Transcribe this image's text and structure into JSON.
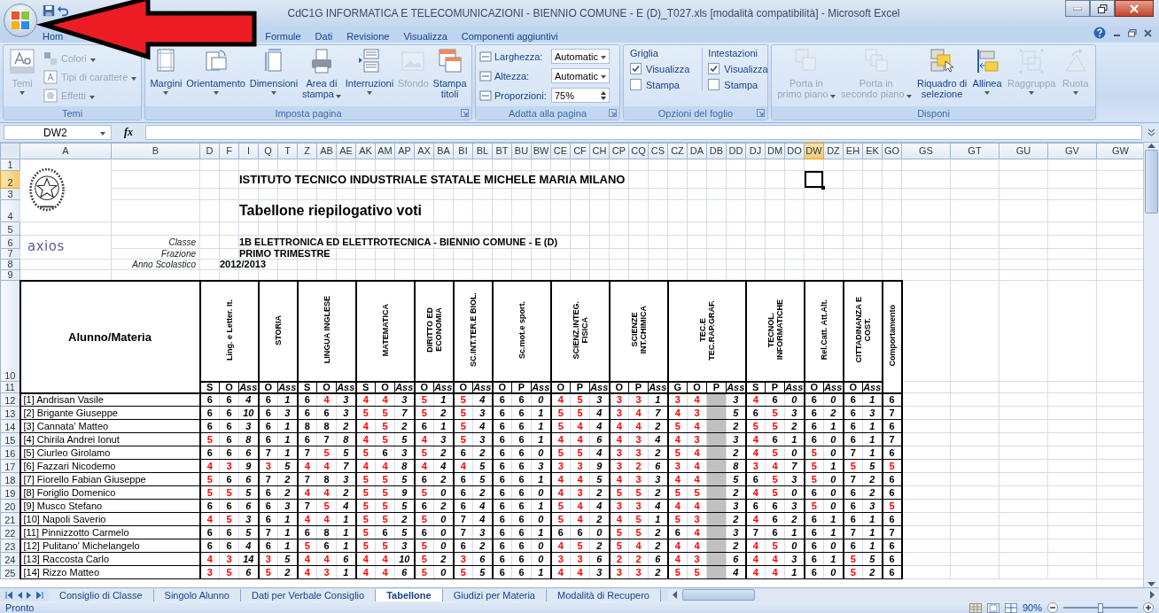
{
  "window": {
    "title": "CdC1G INFORMATICA E TELECOMUNICAZIONI - BIENNIO COMUNE - E (D)_T027.xls  [modalità compatibilità] - Microsoft Excel"
  },
  "ribbon": {
    "tabs": [
      {
        "label": "Hom",
        "selected": false
      },
      {
        "label": "Formule",
        "selected": false
      },
      {
        "label": "Dati",
        "selected": false
      },
      {
        "label": "Revisione",
        "selected": false
      },
      {
        "label": "Visualizza",
        "selected": false
      },
      {
        "label": "Componenti aggiuntivi",
        "selected": false
      }
    ],
    "groups": [
      {
        "kind": "themes",
        "label": "Temi",
        "main": {
          "label": "Temi",
          "disabled": true
        },
        "options": [
          {
            "label": "Colori",
            "disabled": true
          },
          {
            "label": "Tipi di carattere",
            "disabled": true
          },
          {
            "label": "Effetti",
            "disabled": true
          }
        ]
      },
      {
        "kind": "buttons",
        "label": "Imposta pagina",
        "launcher": true,
        "buttons": [
          {
            "label": "Margini",
            "menu": true,
            "disabled": false
          },
          {
            "label": "Orientamento",
            "menu": true,
            "disabled": false
          },
          {
            "label": "Dimensioni",
            "menu": true,
            "disabled": false
          },
          {
            "label": "Area di\nstampa",
            "menu": true,
            "disabled": false
          },
          {
            "label": "Interruzioni",
            "menu": true,
            "disabled": false
          },
          {
            "label": "Sfondo",
            "menu": false,
            "disabled": true
          },
          {
            "label": "Stampa\ntitoli",
            "menu": false,
            "disabled": false
          }
        ]
      },
      {
        "kind": "fit",
        "label": "Adatta alla pagina",
        "launcher": true,
        "fields": [
          {
            "kind": "combo",
            "label": "Larghezza:",
            "value": "Automatic"
          },
          {
            "kind": "combo",
            "label": "Altezza:",
            "value": "Automatic"
          },
          {
            "kind": "spin",
            "label": "Proporzioni:",
            "value": "75%"
          }
        ]
      },
      {
        "kind": "sheet_options",
        "label": "Opzioni del foglio",
        "launcher": true,
        "sections": [
          {
            "heading": "Griglia",
            "options": [
              {
                "label": "Visualizza",
                "checked": true
              },
              {
                "label": "Stampa",
                "checked": false
              }
            ]
          },
          {
            "heading": "Intestazioni",
            "options": [
              {
                "label": "Visualizza",
                "checked": true
              },
              {
                "label": "Stampa",
                "checked": false
              }
            ]
          }
        ]
      },
      {
        "kind": "buttons",
        "label": "Disponi",
        "launcher": false,
        "buttons": [
          {
            "label": "Porta in\nprimo piano",
            "menu": true,
            "disabled": true
          },
          {
            "label": "Porta in\nsecondo piano",
            "menu": true,
            "disabled": true
          },
          {
            "label": "Riquadro di\nselezione",
            "menu": false,
            "disabled": false
          },
          {
            "label": "Allinea",
            "menu": true,
            "disabled": false
          },
          {
            "label": "Raggruppa",
            "menu": true,
            "disabled": true
          },
          {
            "label": "Ruota",
            "menu": true,
            "disabled": true
          }
        ]
      }
    ]
  },
  "formula_bar": {
    "name_box": "DW2",
    "function_label": "fx"
  },
  "grid": {
    "columns": [
      {
        "label": "A",
        "selected": false
      },
      {
        "label": "B",
        "selected": false
      },
      {
        "label": "D",
        "selected": false
      },
      {
        "label": "F",
        "selected": false
      },
      {
        "label": "I",
        "selected": false
      },
      {
        "label": "Q",
        "selected": false
      },
      {
        "label": "T",
        "selected": false
      },
      {
        "label": "Z",
        "selected": false
      },
      {
        "label": "AB",
        "selected": false
      },
      {
        "label": "AE",
        "selected": false
      },
      {
        "label": "AK",
        "selected": false
      },
      {
        "label": "AM",
        "selected": false
      },
      {
        "label": "AP",
        "selected": false
      },
      {
        "label": "AX",
        "selected": false
      },
      {
        "label": "BA",
        "selected": false
      },
      {
        "label": "BI",
        "selected": false
      },
      {
        "label": "BL",
        "selected": false
      },
      {
        "label": "BT",
        "selected": false
      },
      {
        "label": "BU",
        "selected": false
      },
      {
        "label": "BW",
        "selected": false
      },
      {
        "label": "CE",
        "selected": false
      },
      {
        "label": "CF",
        "selected": false
      },
      {
        "label": "CH",
        "selected": false
      },
      {
        "label": "CP",
        "selected": false
      },
      {
        "label": "CQ",
        "selected": false
      },
      {
        "label": "CS",
        "selected": false
      },
      {
        "label": "CZ",
        "selected": false
      },
      {
        "label": "DA",
        "selected": false
      },
      {
        "label": "DB",
        "selected": false
      },
      {
        "label": "DD",
        "selected": false
      },
      {
        "label": "DJ",
        "selected": false
      },
      {
        "label": "DM",
        "selected": false
      },
      {
        "label": "DO",
        "selected": false
      },
      {
        "label": "DW",
        "selected": true
      },
      {
        "label": "DZ",
        "selected": false
      },
      {
        "label": "EH",
        "selected": false
      },
      {
        "label": "EK",
        "selected": false
      },
      {
        "label": "GO",
        "selected": false
      },
      {
        "label": "GS",
        "selected": false
      },
      {
        "label": "GT",
        "selected": false
      },
      {
        "label": "GU",
        "selected": false
      },
      {
        "label": "GV",
        "selected": false
      },
      {
        "label": "GW",
        "selected": false
      }
    ],
    "rows": [
      {
        "label": "1",
        "selected": false
      },
      {
        "label": "2",
        "selected": true
      },
      {
        "label": "3",
        "selected": false
      },
      {
        "label": "4",
        "selected": false
      },
      {
        "label": "5",
        "selected": false
      },
      {
        "label": "6",
        "selected": false
      },
      {
        "label": "7",
        "selected": false
      },
      {
        "label": "8",
        "selected": false
      },
      {
        "label": "9",
        "selected": false
      },
      {
        "label": "10",
        "selected": false
      },
      {
        "label": "11",
        "selected": false
      },
      {
        "label": "12",
        "selected": false
      },
      {
        "label": "13",
        "selected": false
      },
      {
        "label": "14",
        "selected": false
      },
      {
        "label": "15",
        "selected": false
      },
      {
        "label": "16",
        "selected": false
      },
      {
        "label": "17",
        "selected": false
      },
      {
        "label": "18",
        "selected": false
      },
      {
        "label": "19",
        "selected": false
      },
      {
        "label": "20",
        "selected": false
      },
      {
        "label": "21",
        "selected": false
      },
      {
        "label": "22",
        "selected": false
      },
      {
        "label": "23",
        "selected": false
      },
      {
        "label": "24",
        "selected": false
      },
      {
        "label": "25",
        "selected": false
      }
    ],
    "header": {
      "title": "ISTITUTO TECNICO INDUSTRIALE STATALE MICHELE MARIA MILANO",
      "subtitle": "Tabellone riepilogativo voti",
      "logo_text": "axios",
      "fields": [
        {
          "label": "Classe",
          "value": "1B ELETTRONICA ED ELETTROTECNICA - BIENNIO COMUNE - E (D)"
        },
        {
          "label": "Frazione",
          "value": "PRIMO TRIMESTRE"
        },
        {
          "label": "Anno Scolastico",
          "value": "2012/2013"
        }
      ]
    },
    "student_header": "Alunno/Materia",
    "subjects": [
      {
        "name": "Ling. e Letter. It.",
        "columns": [
          {
            "label": "S",
            "kind": "grade"
          },
          {
            "label": "O",
            "kind": "grade"
          },
          {
            "label": "Ass",
            "kind": "absences"
          }
        ]
      },
      {
        "name": "STORIA",
        "columns": [
          {
            "label": "O",
            "kind": "grade"
          },
          {
            "label": "Ass",
            "kind": "absences"
          }
        ]
      },
      {
        "name": "LINGUA INGLESE",
        "columns": [
          {
            "label": "S",
            "kind": "grade"
          },
          {
            "label": "O",
            "kind": "grade"
          },
          {
            "label": "Ass",
            "kind": "absences"
          }
        ]
      },
      {
        "name": "MATEMATICA",
        "columns": [
          {
            "label": "S",
            "kind": "grade"
          },
          {
            "label": "O",
            "kind": "grade"
          },
          {
            "label": "Ass",
            "kind": "absences"
          }
        ]
      },
      {
        "name": "DIRITTO ED\nECONOMIA",
        "columns": [
          {
            "label": "O",
            "kind": "grade"
          },
          {
            "label": "Ass",
            "kind": "absences"
          }
        ]
      },
      {
        "name": "SC.INT.TER.E BIOL.",
        "columns": [
          {
            "label": "O",
            "kind": "grade"
          },
          {
            "label": "Ass",
            "kind": "absences"
          }
        ]
      },
      {
        "name": "Sc.mot.e sport.",
        "columns": [
          {
            "label": "O",
            "kind": "grade"
          },
          {
            "label": "P",
            "kind": "grade"
          },
          {
            "label": "Ass",
            "kind": "absences"
          }
        ]
      },
      {
        "name": "SCIENZ.INTEG.\nFISICA",
        "columns": [
          {
            "label": "O",
            "kind": "grade"
          },
          {
            "label": "P",
            "kind": "grade"
          },
          {
            "label": "Ass",
            "kind": "absences"
          }
        ]
      },
      {
        "name": "SCIENZE\nINT.CHIMICA",
        "columns": [
          {
            "label": "O",
            "kind": "grade"
          },
          {
            "label": "P",
            "kind": "grade"
          },
          {
            "label": "Ass",
            "kind": "absences"
          }
        ]
      },
      {
        "name": "TEC.E\nTEC.RAP.GRAF.",
        "columns": [
          {
            "label": "G",
            "kind": "grade"
          },
          {
            "label": "O",
            "kind": "grade"
          },
          {
            "label": "P",
            "kind": "blocked"
          },
          {
            "label": "Ass",
            "kind": "absences"
          }
        ]
      },
      {
        "name": "TECNOL.\nINFORMATICHE",
        "columns": [
          {
            "label": "S",
            "kind": "grade"
          },
          {
            "label": "P",
            "kind": "grade"
          },
          {
            "label": "Ass",
            "kind": "absences"
          }
        ]
      },
      {
        "name": "Rel.Catt. Att.Alt.",
        "columns": [
          {
            "label": "O",
            "kind": "grade"
          },
          {
            "label": "Ass",
            "kind": "absences"
          }
        ]
      },
      {
        "name": "CITTADINANZA E\nCOST.",
        "columns": [
          {
            "label": "O",
            "kind": "grade"
          },
          {
            "label": "Ass",
            "kind": "absences"
          }
        ]
      },
      {
        "name": "Comportamento",
        "columns": [
          {
            "kind": "grade"
          }
        ]
      }
    ],
    "students": [
      {
        "name": "[1] Andrisan Vasile",
        "cells": [
          "6",
          "6",
          "4",
          "6",
          "1",
          "6",
          "4",
          "3",
          "4",
          "4",
          "3",
          "5",
          "1",
          "5",
          "4",
          "6",
          "6",
          "0",
          "4",
          "5",
          "3",
          "3",
          "3",
          "1",
          "3",
          "4",
          "3",
          "4",
          "6",
          "0",
          "6",
          "0",
          "6",
          "1",
          "6"
        ]
      },
      {
        "name": "[2] Brigante Giuseppe",
        "cells": [
          "6",
          "6",
          "10",
          "6",
          "3",
          "6",
          "6",
          "3",
          "5",
          "5",
          "7",
          "5",
          "2",
          "5",
          "3",
          "6",
          "6",
          "1",
          "5",
          "5",
          "4",
          "3",
          "4",
          "7",
          "4",
          "3",
          "5",
          "6",
          "5",
          "3",
          "6",
          "2",
          "6",
          "3",
          "7"
        ]
      },
      {
        "name": "[3] Cannata' Matteo",
        "cells": [
          "6",
          "6",
          "3",
          "6",
          "1",
          "8",
          "8",
          "2",
          "4",
          "5",
          "2",
          "6",
          "1",
          "5",
          "4",
          "6",
          "6",
          "1",
          "5",
          "4",
          "4",
          "4",
          "4",
          "2",
          "5",
          "4",
          "2",
          "5",
          "5",
          "2",
          "6",
          "1",
          "6",
          "1",
          "6"
        ]
      },
      {
        "name": "[4] Chirila Andrei Ionut",
        "cells": [
          "5",
          "6",
          "8",
          "6",
          "1",
          "6",
          "7",
          "8",
          "4",
          "5",
          "5",
          "4",
          "3",
          "5",
          "3",
          "6",
          "6",
          "1",
          "4",
          "4",
          "6",
          "4",
          "3",
          "4",
          "4",
          "3",
          "3",
          "4",
          "6",
          "1",
          "6",
          "0",
          "6",
          "1",
          "7"
        ]
      },
      {
        "name": "[5] Ciurleo Girolamo",
        "cells": [
          "6",
          "6",
          "6",
          "7",
          "1",
          "7",
          "5",
          "5",
          "5",
          "6",
          "3",
          "5",
          "2",
          "6",
          "2",
          "6",
          "6",
          "0",
          "5",
          "5",
          "4",
          "3",
          "3",
          "2",
          "5",
          "4",
          "2",
          "4",
          "5",
          "0",
          "5",
          "0",
          "7",
          "1",
          "6"
        ]
      },
      {
        "name": "[6] Fazzari Nicodemo",
        "cells": [
          "4",
          "3",
          "9",
          "3",
          "5",
          "4",
          "4",
          "7",
          "4",
          "4",
          "8",
          "4",
          "4",
          "4",
          "5",
          "6",
          "6",
          "3",
          "3",
          "3",
          "9",
          "3",
          "2",
          "6",
          "3",
          "4",
          "8",
          "3",
          "4",
          "7",
          "5",
          "1",
          "5",
          "5",
          "5"
        ]
      },
      {
        "name": "[7] Fiorello Fabian Giuseppe",
        "cells": [
          "5",
          "6",
          "6",
          "7",
          "2",
          "7",
          "8",
          "3",
          "5",
          "5",
          "5",
          "6",
          "2",
          "6",
          "5",
          "6",
          "6",
          "1",
          "4",
          "4",
          "5",
          "4",
          "3",
          "3",
          "4",
          "4",
          "5",
          "6",
          "5",
          "3",
          "5",
          "0",
          "7",
          "2",
          "6"
        ]
      },
      {
        "name": "[8] Foriglio Domenico",
        "cells": [
          "5",
          "5",
          "5",
          "6",
          "2",
          "4",
          "4",
          "2",
          "5",
          "5",
          "9",
          "5",
          "0",
          "6",
          "2",
          "6",
          "6",
          "0",
          "4",
          "3",
          "2",
          "5",
          "5",
          "2",
          "5",
          "5",
          "2",
          "4",
          "5",
          "0",
          "6",
          "0",
          "6",
          "2",
          "6"
        ]
      },
      {
        "name": "[9] Musco Stefano",
        "cells": [
          "6",
          "6",
          "6",
          "6",
          "3",
          "7",
          "5",
          "4",
          "5",
          "5",
          "5",
          "6",
          "2",
          "6",
          "4",
          "6",
          "6",
          "1",
          "5",
          "4",
          "4",
          "3",
          "3",
          "4",
          "4",
          "4",
          "3",
          "6",
          "6",
          "3",
          "5",
          "0",
          "6",
          "3",
          "5"
        ]
      },
      {
        "name": "[10] Napoli Saverio",
        "cells": [
          "4",
          "5",
          "3",
          "6",
          "1",
          "4",
          "4",
          "1",
          "5",
          "5",
          "2",
          "5",
          "0",
          "7",
          "4",
          "6",
          "6",
          "0",
          "5",
          "4",
          "2",
          "4",
          "5",
          "1",
          "5",
          "3",
          "2",
          "4",
          "6",
          "2",
          "6",
          "1",
          "6",
          "1",
          "6"
        ]
      },
      {
        "name": "[11] Pinnizzotto Carmelo",
        "cells": [
          "6",
          "6",
          "5",
          "7",
          "1",
          "6",
          "8",
          "1",
          "5",
          "6",
          "5",
          "6",
          "0",
          "7",
          "3",
          "6",
          "6",
          "1",
          "6",
          "6",
          "0",
          "5",
          "5",
          "2",
          "6",
          "4",
          "3",
          "7",
          "6",
          "1",
          "6",
          "1",
          "7",
          "1",
          "7"
        ]
      },
      {
        "name": "[12] Pulitano' Michelangelo",
        "cells": [
          "6",
          "6",
          "4",
          "6",
          "1",
          "5",
          "6",
          "1",
          "5",
          "5",
          "3",
          "5",
          "0",
          "6",
          "2",
          "6",
          "6",
          "0",
          "4",
          "5",
          "2",
          "5",
          "4",
          "2",
          "4",
          "4",
          "2",
          "4",
          "5",
          "0",
          "6",
          "0",
          "6",
          "1",
          "6"
        ]
      },
      {
        "name": "[13] Raccosta Carlo",
        "cells": [
          "4",
          "3",
          "14",
          "3",
          "5",
          "4",
          "4",
          "6",
          "4",
          "4",
          "10",
          "5",
          "2",
          "3",
          "6",
          "6",
          "6",
          "0",
          "3",
          "3",
          "6",
          "2",
          "2",
          "6",
          "4",
          "3",
          "6",
          "4",
          "4",
          "3",
          "6",
          "1",
          "5",
          "5",
          "6"
        ]
      },
      {
        "name": "[14] Rizzo Matteo",
        "cells": [
          "3",
          "5",
          "6",
          "5",
          "2",
          "4",
          "3",
          "1",
          "4",
          "4",
          "6",
          "5",
          "0",
          "5",
          "5",
          "6",
          "6",
          "1",
          "4",
          "4",
          "3",
          "3",
          "3",
          "2",
          "5",
          "5",
          "4",
          "4",
          "4",
          "1",
          "6",
          "0",
          "5",
          "2",
          "6"
        ]
      }
    ]
  },
  "sheet_tabs": [
    {
      "label": "Consiglio di Classe",
      "selected": false
    },
    {
      "label": "Singolo Alunno",
      "selected": false
    },
    {
      "label": "Dati per Verbale Consiglio",
      "selected": false
    },
    {
      "label": "Tabellone",
      "selected": true
    },
    {
      "label": "Giudizi per Materia",
      "selected": false
    },
    {
      "label": "Modalità di Recupero",
      "selected": false
    }
  ],
  "status_bar": {
    "text": "Pronto",
    "zoom": "90%",
    "level": 0.5
  }
}
